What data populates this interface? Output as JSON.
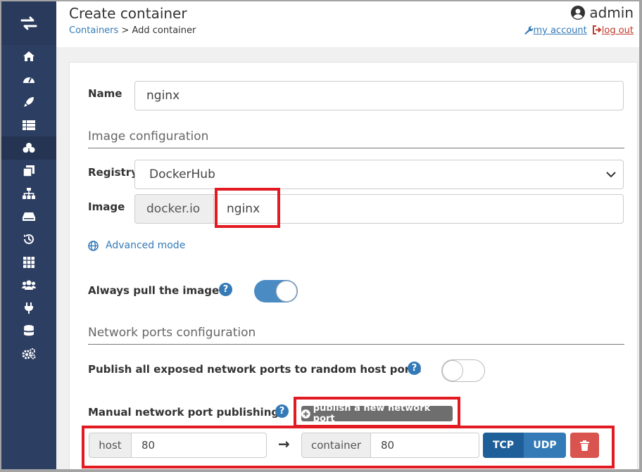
{
  "header": {
    "title": "Create container",
    "breadcrumb_link": "Containers",
    "breadcrumb_current": "> Add container",
    "username": "admin",
    "my_account": "my account",
    "logout": "log out"
  },
  "sidebar": {
    "items": [
      {
        "icon": "home-icon"
      },
      {
        "icon": "dashboard-icon"
      },
      {
        "icon": "rocket-icon"
      },
      {
        "icon": "list-icon"
      },
      {
        "icon": "cubes-icon",
        "active": true
      },
      {
        "icon": "clone-icon"
      },
      {
        "icon": "sitemap-icon"
      },
      {
        "icon": "hdd-icon"
      },
      {
        "icon": "history-icon"
      },
      {
        "icon": "grid-icon"
      },
      {
        "icon": "users-icon"
      },
      {
        "icon": "plug-icon"
      },
      {
        "icon": "database-icon"
      },
      {
        "icon": "cogs-icon"
      }
    ]
  },
  "form": {
    "name_label": "Name",
    "name_value": "nginx",
    "image_section": "Image configuration",
    "registry_label": "Registry",
    "registry_value": "DockerHub",
    "image_label": "Image",
    "image_prefix": "docker.io",
    "image_value": "nginx",
    "advanced_mode": "Advanced mode",
    "always_pull_label": "Always pull the image",
    "always_pull_on": true,
    "network_section": "Network ports configuration",
    "publish_all_label": "Publish all exposed network ports to random host ports",
    "publish_all_on": false,
    "manual_label": "Manual network port publishing",
    "publish_button": "publish a new network port",
    "port": {
      "host_label": "host",
      "host_value": "80",
      "arrow": "→",
      "container_label": "container",
      "container_value": "80",
      "tcp": "TCP",
      "udp": "UDP"
    }
  },
  "colors": {
    "sidebar": "#2d3e63",
    "link": "#337ab7",
    "toggle_on": "#4a8bc4",
    "tcp_active": "#1f5f99",
    "udp": "#337ab7",
    "danger": "#d9534f",
    "highlight": "#e21b23"
  }
}
